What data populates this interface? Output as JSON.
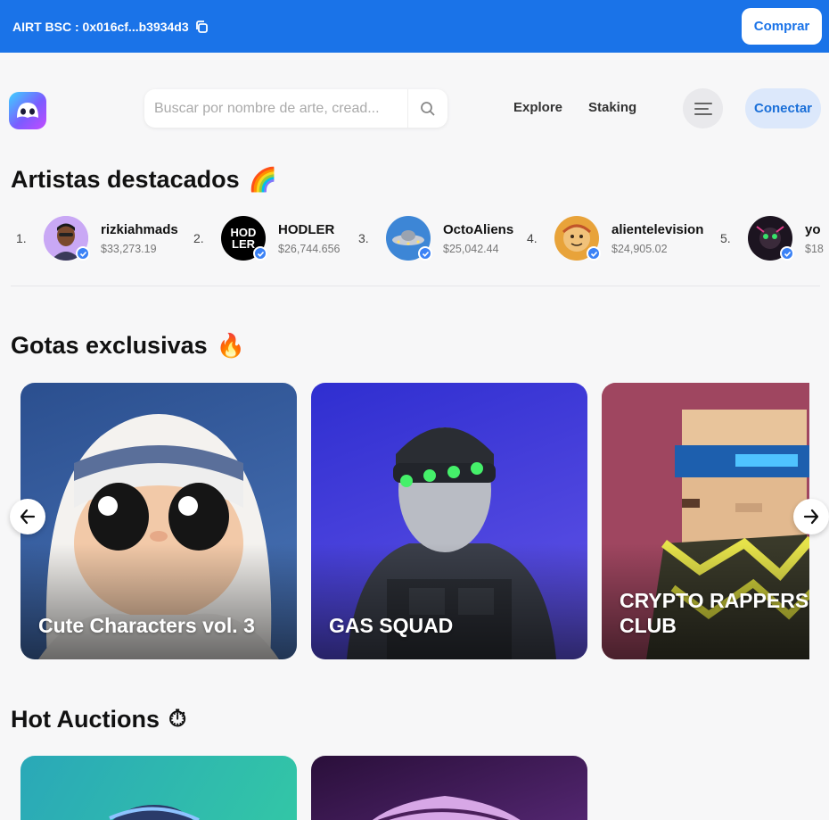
{
  "topbar": {
    "contract_label": "AIRT BSC : 0x016cf...b3934d3",
    "buy_label": "Comprar",
    "copy_icon": "copy-icon"
  },
  "header": {
    "search_placeholder": "Buscar por nombre de arte, cread...",
    "nav": {
      "explore": "Explore",
      "staking": "Staking"
    },
    "connect_label": "Conectar"
  },
  "featured": {
    "title": "Artistas destacados",
    "emoji": "🌈",
    "artists": [
      {
        "rank": "1.",
        "name": "rizkiahmads",
        "volume": "$33,273.19"
      },
      {
        "rank": "2.",
        "name": "HODLER",
        "volume": "$26,744.656"
      },
      {
        "rank": "3.",
        "name": "OctoAliens",
        "volume": "$25,042.44"
      },
      {
        "rank": "4.",
        "name": "alientelevision",
        "volume": "$24,905.02"
      },
      {
        "rank": "5.",
        "name": "yo",
        "volume": "$18"
      }
    ],
    "hodler_logo_text": "HOD LER"
  },
  "drops": {
    "title": "Gotas exclusivas",
    "emoji": "🔥",
    "cards": [
      {
        "title": "Cute Characters vol. 3"
      },
      {
        "title": "GAS SQUAD"
      },
      {
        "title": "CRYPTO RAPPERS CLUB"
      }
    ]
  },
  "auctions": {
    "title": "Hot Auctions",
    "emoji": "⏱"
  },
  "colors": {
    "brand_blue": "#1a73e8",
    "verified_blue": "#3b82f6",
    "connect_bg": "#dce8fb"
  }
}
